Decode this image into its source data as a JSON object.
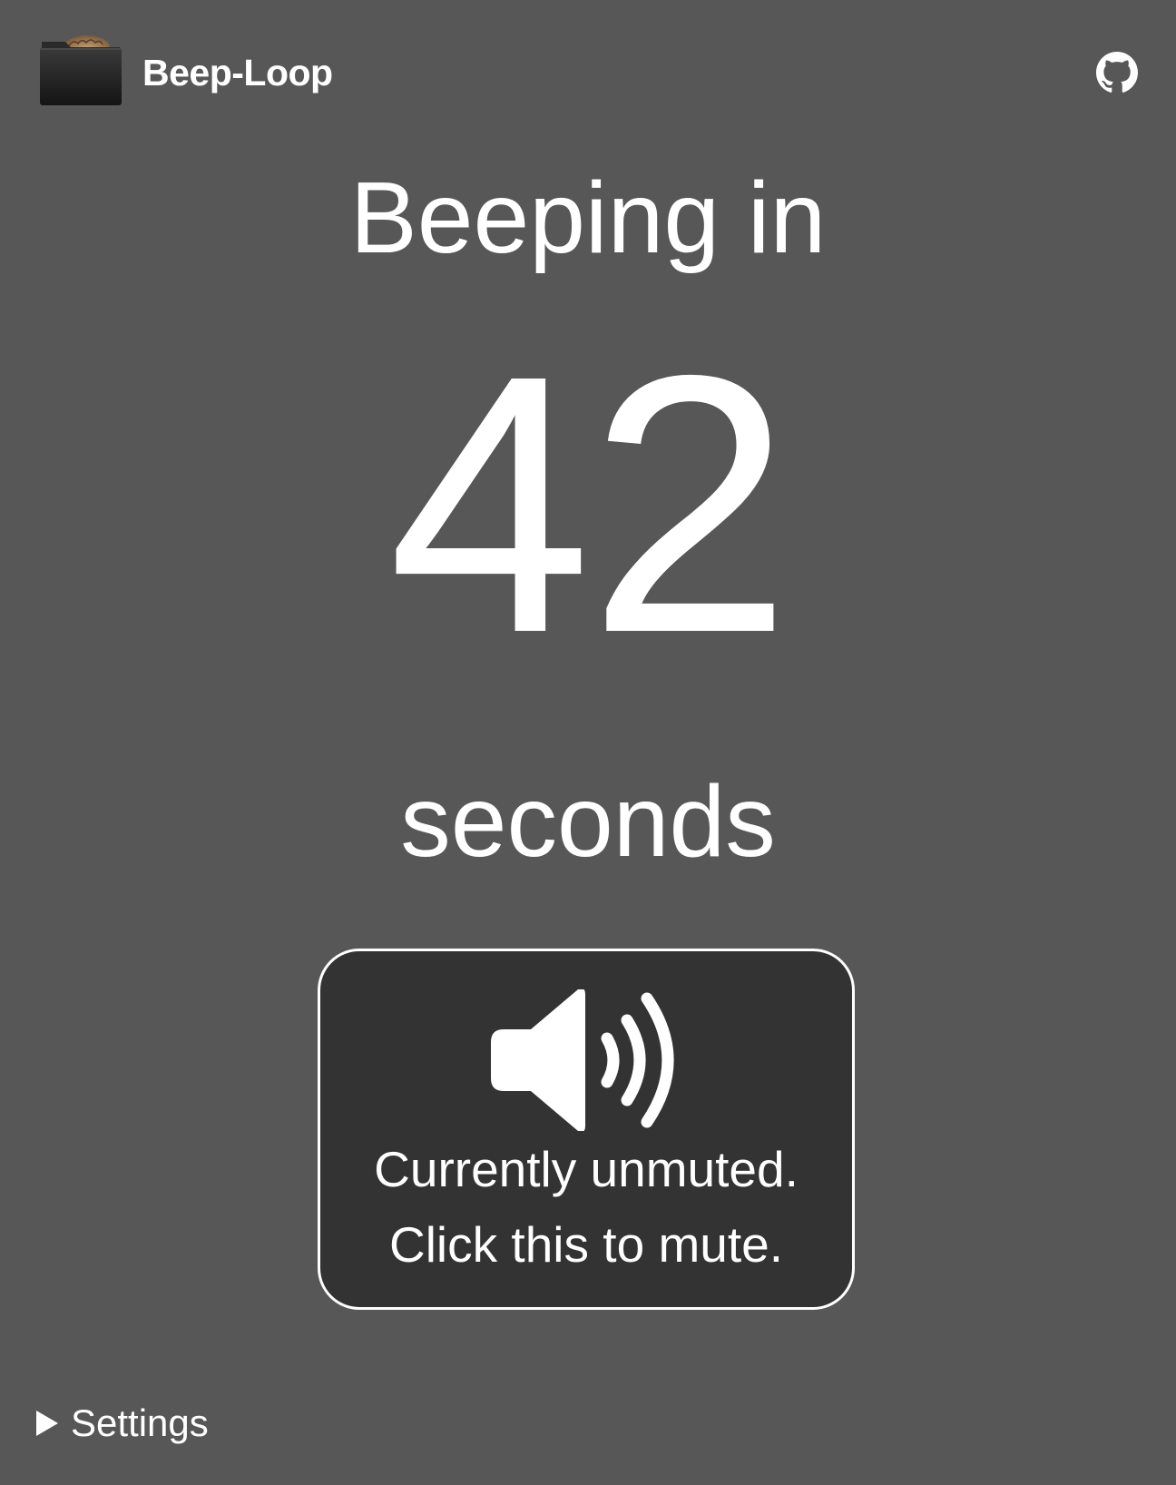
{
  "header": {
    "app_title": "Beep-Loop",
    "logo_icon": "folder-with-brain-icon",
    "github_icon": "github-icon"
  },
  "countdown": {
    "prefix_text": "Beeping in",
    "value": "42",
    "unit_text": "seconds"
  },
  "mute_button": {
    "icon": "speaker-sound-icon",
    "status_text": "Currently unmuted.",
    "action_text": "Click this to mute."
  },
  "settings": {
    "label": "Settings",
    "icon": "disclosure-triangle-right-icon",
    "expanded": false
  },
  "colors": {
    "background": "#575757",
    "button_background": "#333333",
    "foreground": "#ffffff"
  }
}
